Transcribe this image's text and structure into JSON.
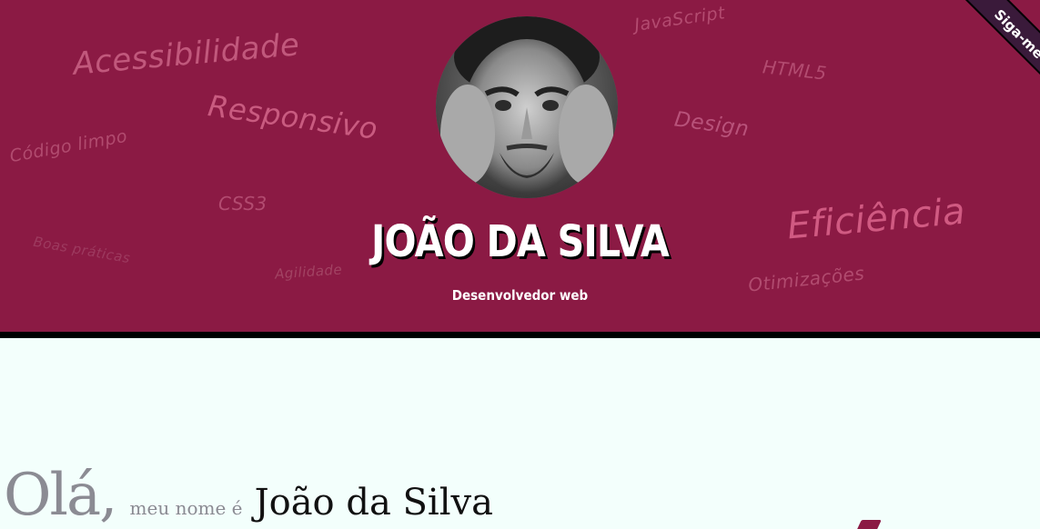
{
  "header": {
    "name": "JOÃO DA SILVA",
    "role": "Desenvolvedor web",
    "ribbon_label": "Siga-me",
    "tags": {
      "acessibilidade": "Acessibilidade",
      "responsivo": "Responsivo",
      "codigo_limpo": "Código limpo",
      "css3": "CSS3",
      "boas_praticas": "Boas práticas",
      "agilidade": "Agilidade",
      "javascript": "JavaScript",
      "html5": "HTML5",
      "design": "Design",
      "eficiencia": "Eficiência",
      "otimizacoes": "Otimizações"
    },
    "colors": {
      "background": "#8b1a44",
      "tag": "#c1587c",
      "border": "#000000"
    }
  },
  "intro": {
    "greeting": "Olá,",
    "lead": "meu nome é",
    "name": "João da Silva"
  },
  "page": {
    "background": "#f3fffc"
  }
}
